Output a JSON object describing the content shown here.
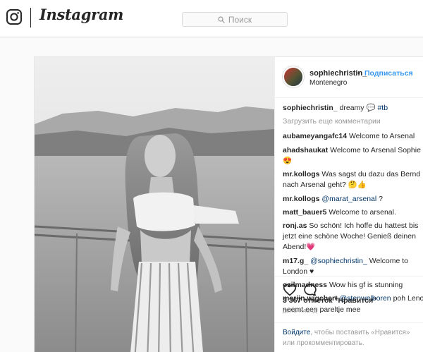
{
  "nav": {
    "brand": "Instagram",
    "search_placeholder": "Поиск"
  },
  "post": {
    "username": "sophiechristin_",
    "bullet": "•",
    "follow_label": "Подписаться",
    "location": "Montenegro",
    "caption": {
      "user": "sophiechristin_",
      "text": " dreamy ",
      "emoji": "💬",
      "hashtag": "#tb"
    },
    "load_more": "Загрузить еще комментарии",
    "comments": [
      {
        "user": "aubameyangafc14",
        "text": " Welcome to Arsenal"
      },
      {
        "user": "ahadshaukat",
        "text": " Welcome to Arsenal Sophie 😍"
      },
      {
        "user": "mr.kollogs",
        "text": " Was sagst du dazu das Bernd nach Arsenal geht? 🤔👍"
      },
      {
        "user": "mr.kollogs",
        "mention": " @marat_arsenal",
        "text": " ?"
      },
      {
        "user": "matt_bauer5",
        "text": " Welcome to arsenal."
      },
      {
        "user": "ronj.as",
        "text": " So schön! Ich hoffe du hattest bis jetzt eine schöne Woche! Genieß deinen Abend!",
        "heart": "💗"
      },
      {
        "user": "m17.g_",
        "mention": " @sophiechristin_",
        "text": " Welcome to London ♥"
      },
      {
        "user": "ozilmadness",
        "text": " Wow his gf is stunning"
      },
      {
        "user": "marijn.wigchert",
        "mention": " @stenwelboren",
        "text": " poh Leno neemt een pareltje mee"
      }
    ],
    "likes": "3 367 отметок \"Нравится\"",
    "time_ago": "ДЕНЬ НАЗАД",
    "login_link": "Войдите",
    "login_text": ", чтобы поставить «Нравится» или прокомментировать.",
    "icons": {
      "like": "heart-icon",
      "comment": "comment-bubble-icon",
      "search": "search-icon",
      "logo": "instagram-glyph-icon"
    },
    "colors": {
      "accent": "#3897f0",
      "mention": "#003569",
      "muted": "#999999"
    }
  }
}
